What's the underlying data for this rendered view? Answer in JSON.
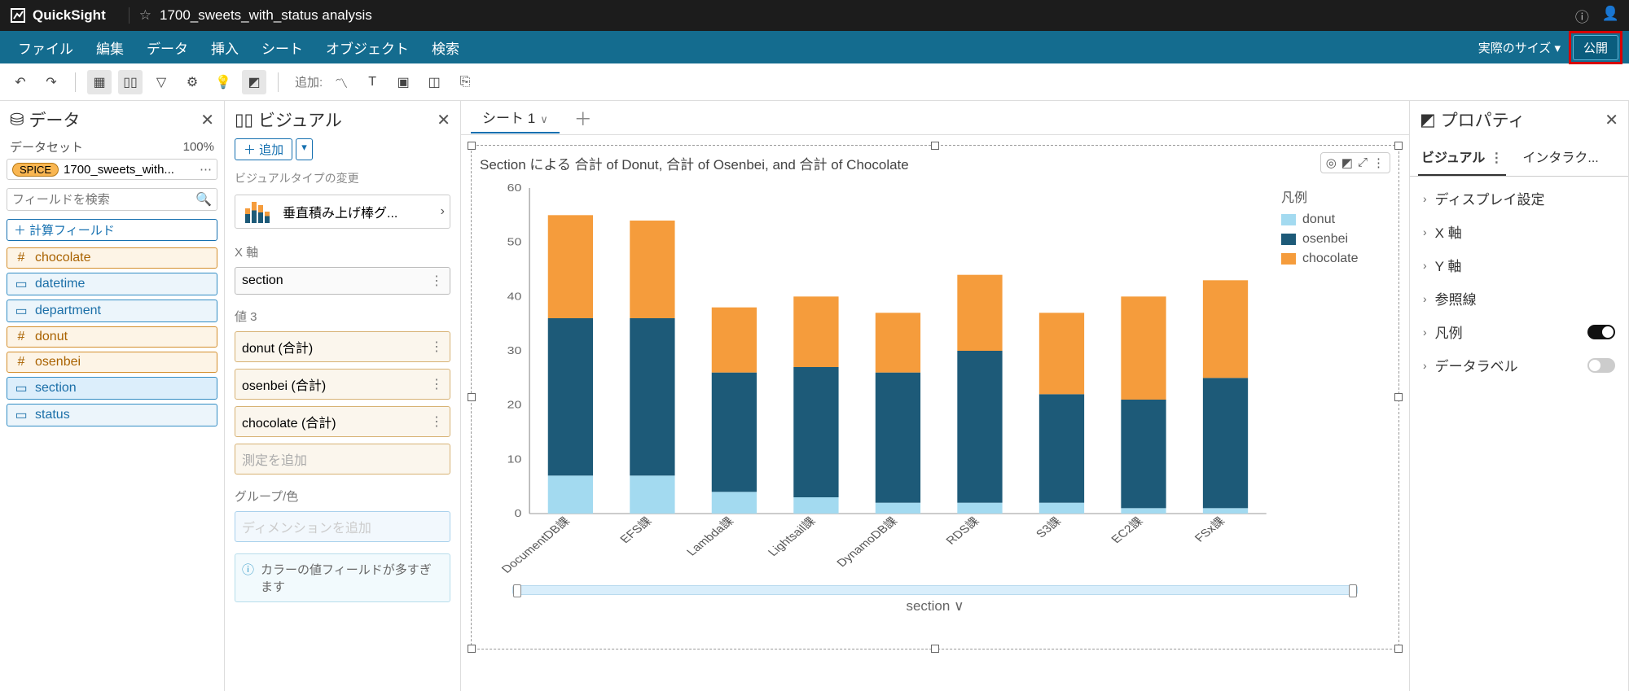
{
  "app_name": "QuickSight",
  "analysis_title": "1700_sweets_with_status analysis",
  "menubar": {
    "items": [
      "ファイル",
      "編集",
      "データ",
      "挿入",
      "シート",
      "オブジェクト",
      "検索"
    ],
    "size_label": "実際のサイズ",
    "publish": "公開"
  },
  "toolbar": {
    "add_label": "追加:"
  },
  "data_panel": {
    "title": "データ",
    "dataset_label": "データセット",
    "pct": "100%",
    "spice_label": "SPICE",
    "dataset_name": "1700_sweets_with...",
    "search_placeholder": "フィールドを検索",
    "calc_btn": "計算フィールド",
    "fields": [
      {
        "name": "chocolate",
        "type": "num"
      },
      {
        "name": "datetime",
        "type": "dim"
      },
      {
        "name": "department",
        "type": "dim"
      },
      {
        "name": "donut",
        "type": "num"
      },
      {
        "name": "osenbei",
        "type": "num"
      },
      {
        "name": "section",
        "type": "dim",
        "selected": true
      },
      {
        "name": "status",
        "type": "dim"
      }
    ]
  },
  "visual_panel": {
    "title": "ビジュアル",
    "add": "追加",
    "type_change": "ビジュアルタイプの変更",
    "type_name": "垂直積み上げ棒グ...",
    "x_axis_label": "X 軸",
    "x_axis_field": "section",
    "value_label": "値 3",
    "value_wells": [
      "donut (合計)",
      "osenbei (合計)",
      "chocolate (合計)"
    ],
    "value_placeholder": "測定を追加",
    "group_label": "グループ/色",
    "group_placeholder": "ディメンションを追加",
    "info": "カラーの値フィールドが多すぎます"
  },
  "canvas": {
    "sheet_tab": "シート 1",
    "viz_title": "Section による 合計 of Donut, 合計 of Osenbei, and 合計 of Chocolate",
    "legend_title": "凡例",
    "x_caption": "section"
  },
  "legend_items": [
    {
      "name": "donut",
      "color": "#a3daf0"
    },
    {
      "name": "osenbei",
      "color": "#1d5a78"
    },
    {
      "name": "chocolate",
      "color": "#f59c3c"
    }
  ],
  "prop_panel": {
    "title": "プロパティ",
    "tab_visual": "ビジュアル",
    "tab_interact": "インタラク...",
    "rows": [
      {
        "label": "ディスプレイ設定",
        "toggle": null
      },
      {
        "label": "X 軸",
        "toggle": null
      },
      {
        "label": "Y 軸",
        "toggle": null
      },
      {
        "label": "参照線",
        "toggle": null
      },
      {
        "label": "凡例",
        "toggle": true
      },
      {
        "label": "データラベル",
        "toggle": false
      }
    ]
  },
  "chart_data": {
    "type": "bar",
    "stacked": true,
    "title": "Section による 合計 of Donut, 合計 of Osenbei, and 合計 of Chocolate",
    "xlabel": "section",
    "ylabel": "",
    "ylim": [
      0,
      60
    ],
    "yticks": [
      0,
      10,
      20,
      30,
      40,
      50,
      60
    ],
    "categories": [
      "DocumentDB課",
      "EFS課",
      "Lambda課",
      "Lightsail課",
      "DynamoDB課",
      "RDS課",
      "S3課",
      "EC2課",
      "FSx課"
    ],
    "series": [
      {
        "name": "donut",
        "color": "#a3daf0",
        "values": [
          7,
          7,
          4,
          3,
          2,
          2,
          2,
          1,
          1
        ]
      },
      {
        "name": "osenbei",
        "color": "#1d5a78",
        "values": [
          29,
          29,
          22,
          24,
          24,
          28,
          20,
          20,
          24
        ]
      },
      {
        "name": "chocolate",
        "color": "#f59c3c",
        "values": [
          19,
          18,
          12,
          13,
          11,
          14,
          15,
          19,
          18
        ]
      }
    ],
    "legend_position": "right"
  }
}
